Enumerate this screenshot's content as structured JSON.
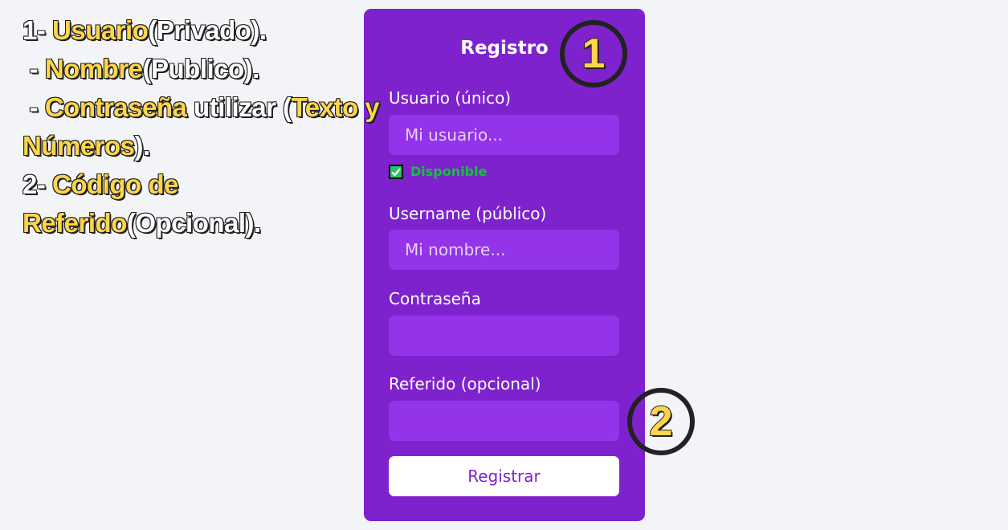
{
  "annotation": {
    "lines": [
      [
        {
          "t": "1- ",
          "c": "w"
        },
        {
          "t": "Usuario",
          "c": "y"
        },
        {
          "t": "(Privado).",
          "c": "w"
        }
      ],
      [
        {
          "t": " - ",
          "c": "w"
        },
        {
          "t": "Nombre",
          "c": "y"
        },
        {
          "t": "(Publico).",
          "c": "w"
        }
      ],
      [
        {
          "t": " - ",
          "c": "w"
        },
        {
          "t": "Contraseña",
          "c": "y"
        },
        {
          "t": " utilizar (",
          "c": "w"
        },
        {
          "t": "Texto y",
          "c": "y"
        }
      ],
      [
        {
          "t": "Números",
          "c": "y"
        },
        {
          "t": ").",
          "c": "w"
        }
      ],
      [
        {
          "t": "2- ",
          "c": "w"
        },
        {
          "t": "Código de",
          "c": "y"
        }
      ],
      [
        {
          "t": "Referido",
          "c": "y"
        },
        {
          "t": "(Opcional).",
          "c": "w"
        }
      ]
    ]
  },
  "form": {
    "title": "Registro",
    "usuario_label": "Usuario (único)",
    "usuario_placeholder": "Mi usuario...",
    "availability_text": "Disponible",
    "username_label": "Username (público)",
    "username_placeholder": "Mi nombre...",
    "password_label": "Contraseña",
    "referido_label": "Referido (opcional)",
    "submit_label": "Registrar"
  },
  "badges": {
    "one": "1",
    "two": "2"
  },
  "colors": {
    "background": "#f2f4f7",
    "card": "#7e22ce",
    "input": "#9333ea",
    "highlight": "#ffd54a",
    "available": "#16c040"
  }
}
